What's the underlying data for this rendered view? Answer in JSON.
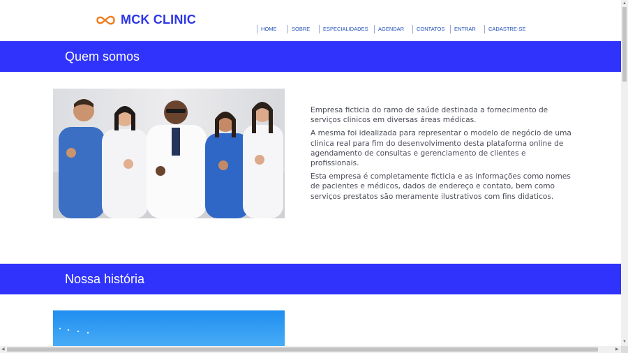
{
  "brand": {
    "name": "MCK CLINIC",
    "logo_icon": "infinity-icon",
    "accent": "#f07c1b",
    "brand_color": "#2d36e6"
  },
  "nav": {
    "items": [
      {
        "label": "HOME"
      },
      {
        "label": "SOBRE"
      },
      {
        "label": "ESPECIALIDADES"
      },
      {
        "label": "AGENDAR"
      },
      {
        "label": "CONTATOS"
      },
      {
        "label": "ENTRAR"
      },
      {
        "label": "CADASTRE-SE"
      }
    ]
  },
  "about": {
    "heading": "Quem somos",
    "paragraphs": [
      "Empresa ficticia do ramo de saúde destinada a fornecimento de serviços clinicos em diversas áreas médicas.",
      "A mesma foi idealizada para representar o modelo de negócio de uma clinica real para fim do desenvolvimento desta plataforma online de agendamento de consultas e gerenciamento de clientes e profissionais.",
      "Esta empresa é completamente ficticia e as informações como nomes de pacientes e médicos, dados de endereço e contato, bem como serviços prestatos são meramente ilustrativos com fins didaticos."
    ],
    "photo": "team-of-doctors-thumbs-up"
  },
  "history": {
    "heading": "Nossa história",
    "photo": "blue-sky-image"
  },
  "colors": {
    "banner": "#2f33fb",
    "nav_text": "#1f4fb8",
    "body_text": "#4a4d57"
  }
}
